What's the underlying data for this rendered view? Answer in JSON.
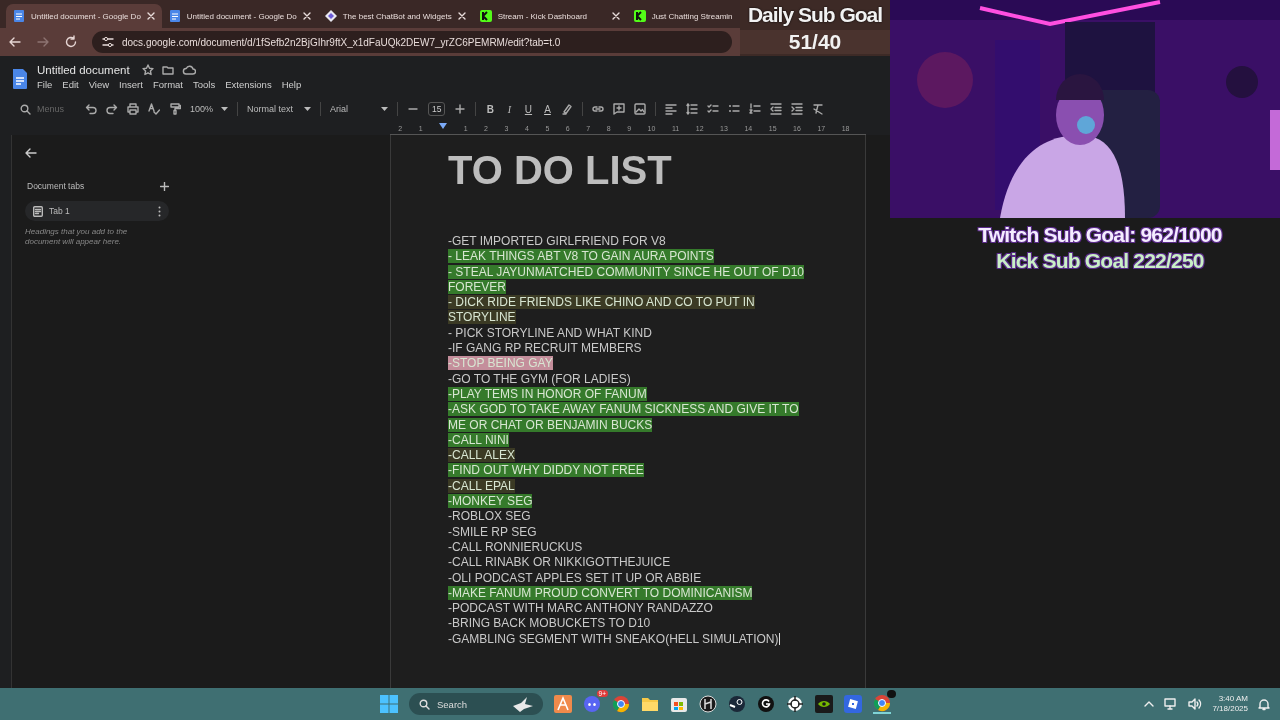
{
  "browser": {
    "tabs": [
      {
        "title": "Untitled document - Google Do",
        "kind": "docs",
        "selected": true
      },
      {
        "title": "Untitled document - Google Do",
        "kind": "docs",
        "selected": false
      },
      {
        "title": "The best ChatBot and Widgets",
        "kind": "bot",
        "selected": false
      },
      {
        "title": "Stream - Kick Dashboard",
        "kind": "kick",
        "selected": false
      },
      {
        "title": "Just Chatting Streamin",
        "kind": "kick",
        "selected": false
      }
    ],
    "url": "docs.google.com/document/d/1fSefb2n2BjGIhr9ftX_x1dFaUQk2DEW7_yrZC6PEMRM/edit?tab=t.0"
  },
  "docs": {
    "title": "Untitled document",
    "menu": [
      "File",
      "Edit",
      "View",
      "Insert",
      "Format",
      "Tools",
      "Extensions",
      "Help"
    ],
    "toolbar": {
      "search_placeholder": "Menus",
      "zoom": "100%",
      "style": "Normal text",
      "font": "Arial",
      "font_size": "15",
      "format_letters": [
        "B",
        "I",
        "U",
        "A"
      ]
    },
    "ruler": [
      "2",
      "1",
      "1",
      "2",
      "3",
      "4",
      "5",
      "6",
      "7",
      "8",
      "9",
      "10",
      "11",
      "12",
      "13",
      "14",
      "15",
      "16",
      "17",
      "18"
    ],
    "sidebar": {
      "heading": "Document tabs",
      "tabs": [
        {
          "label": "Tab 1",
          "selected": true
        }
      ],
      "hint": "Headings that you add to the document will appear here."
    },
    "document": {
      "title": "TO DO LIST",
      "items": [
        {
          "lines": [
            "-GET IMPORTED GIRLFRIEND FOR V8"
          ]
        },
        {
          "lines": [
            "- LEAK THINGS ABT V8 TO GAIN AURA POINTS"
          ],
          "color": "#357a2b"
        },
        {
          "lines": [
            "- STEAL JAYUNMATCHED COMMUNITY SINCE HE OUT OF D10",
            "FOREVER"
          ],
          "color": "#357a2b"
        },
        {
          "lines": [
            "- DICK RIDE FRIENDS LIKE CHINO AND CO TO PUT IN",
            "STORYLINE"
          ],
          "color": "#3b3a24"
        },
        {
          "lines": [
            "- PICK STORYLINE AND WHAT KIND"
          ]
        },
        {
          "lines": [
            "-IF GANG RP RECRUIT MEMBERS"
          ]
        },
        {
          "lines": [
            "-STOP BEING GAY"
          ],
          "color": "#c48e9b"
        },
        {
          "lines": [
            "-GO TO THE GYM (FOR LADIES)"
          ]
        },
        {
          "lines": [
            "-PLAY TEMS IN HONOR OF FANUM"
          ],
          "color": "#357a2b"
        },
        {
          "lines": [
            "-ASK GOD TO TAKE AWAY FANUM SICKNESS AND GIVE IT TO",
            "ME OR CHAT OR BENJAMIN BUCKS"
          ],
          "color": "#357a2b"
        },
        {
          "lines": [
            "-CALL NINI"
          ],
          "color": "#357a2b"
        },
        {
          "lines": [
            "-CALL ALEX"
          ],
          "color": "#3b3a24"
        },
        {
          "lines": [
            "-FIND OUT WHY DIDDY NOT FREE"
          ],
          "color": "#357a2b"
        },
        {
          "lines": [
            "-CALL EPAL"
          ],
          "color": "#3b3a24"
        },
        {
          "lines": [
            "-MONKEY SEG"
          ],
          "color": "#357a2b"
        },
        {
          "lines": [
            "-ROBLOX SEG"
          ]
        },
        {
          "lines": [
            "-SMILE RP SEG"
          ]
        },
        {
          "lines": [
            "-CALL RONNIERUCKUS"
          ]
        },
        {
          "lines": [
            "-CALL RINABK OR NIKKIGOTTHEJUICE"
          ]
        },
        {
          "lines": [
            "-OLI PODCAST APPLES SET IT UP OR ABBIE"
          ]
        },
        {
          "lines": [
            "-MAKE FANUM PROUD CONVERT TO DOMINICANISM"
          ],
          "color": "#357a2b"
        },
        {
          "lines": [
            "-PODCAST WITH MARC ANTHONY RANDAZZO"
          ]
        },
        {
          "lines": [
            "-BRING BACK MOBUCKETS TO D10"
          ]
        },
        {
          "lines": [
            "-GAMBLING SEGMENT WITH SNEAKO(HELL SIMULATION)"
          ]
        }
      ]
    }
  },
  "overlays": {
    "daily_goal": {
      "title": "Daily Sub Goal",
      "count": "51/40"
    },
    "goals": [
      {
        "text": "Twitch Sub Goal: 962/1000",
        "color": "#f4ecff"
      },
      {
        "text": "Kick Sub Goal 222/250",
        "color": "#c9efc6"
      }
    ]
  },
  "taskbar": {
    "search_placeholder": "Search",
    "chat_badge": "9+",
    "time": "3:40 AM",
    "date": "7/18/2025"
  }
}
